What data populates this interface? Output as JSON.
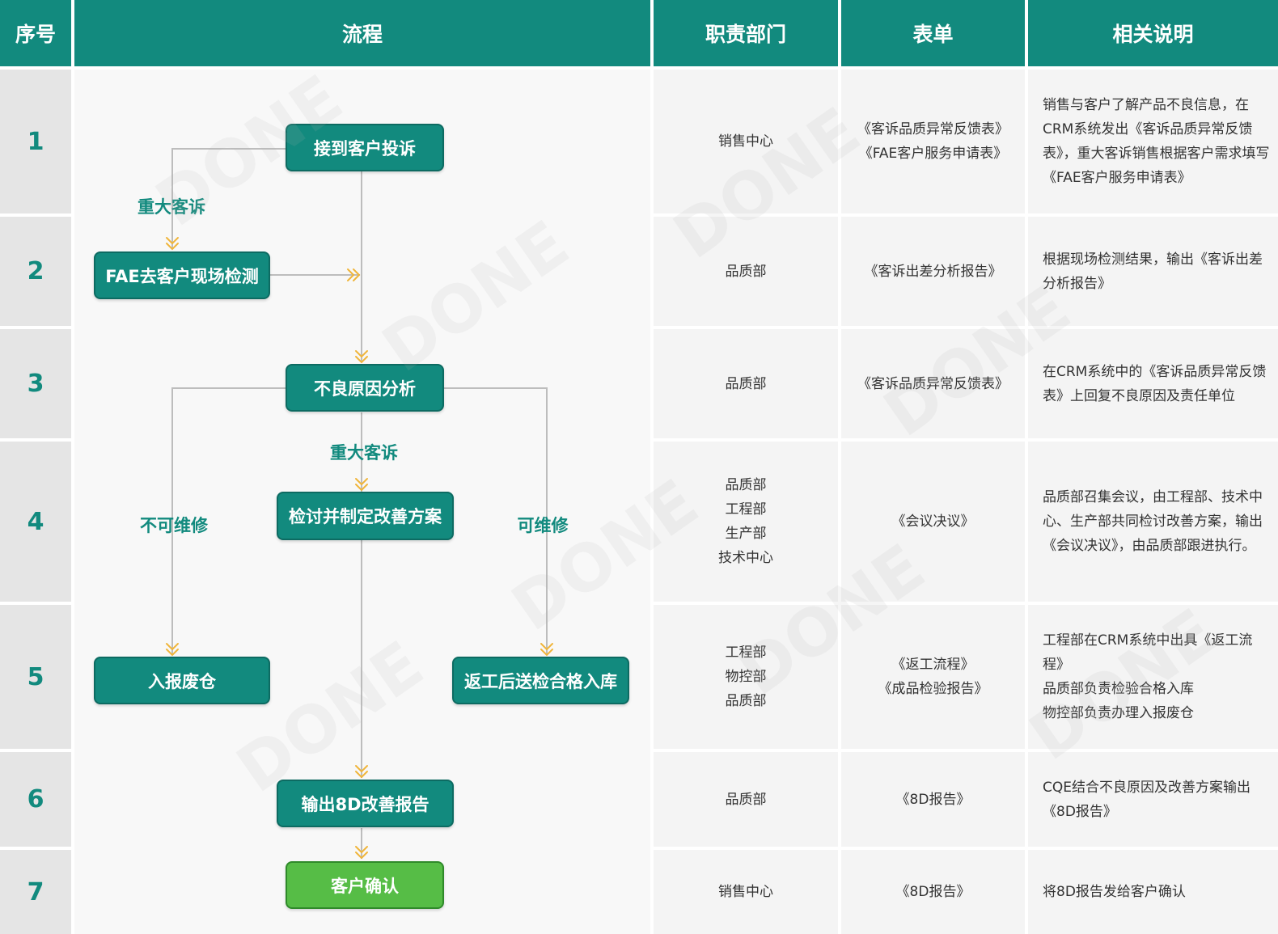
{
  "headers": {
    "seq": "序号",
    "flow": "流程",
    "dept": "职责部门",
    "form": "表单",
    "desc": "相关说明"
  },
  "rows": [
    {
      "seq": "1",
      "dept": "销售中心",
      "form": "《客诉品质异常反馈表》\n《FAE客户服务申请表》",
      "desc": "销售与客户了解产品不良信息，在CRM系统发出《客诉品质异常反馈表》，重大客诉销售根据客户需求填写《FAE客户服务申请表》"
    },
    {
      "seq": "2",
      "dept": "品质部",
      "form": "《客诉出差分析报告》",
      "desc": "根据现场检测结果，输出《客诉出差分析报告》"
    },
    {
      "seq": "3",
      "dept": "品质部",
      "form": "《客诉品质异常反馈表》",
      "desc": "在CRM系统中的《客诉品质异常反馈表》上回复不良原因及责任单位"
    },
    {
      "seq": "4",
      "dept": "品质部\n工程部\n生产部\n技术中心",
      "form": "《会议决议》",
      "desc": "品质部召集会议，由工程部、技术中心、生产部共同检讨改善方案，输出《会议决议》，由品质部跟进执行。"
    },
    {
      "seq": "5",
      "dept": "工程部\n物控部\n品质部",
      "form": "《返工流程》\n《成品检验报告》",
      "desc": "工程部在CRM系统中出具《返工流程》\n品质部负责检验合格入库\n物控部负责办理入报废仓"
    },
    {
      "seq": "6",
      "dept": "品质部",
      "form": "《8D报告》",
      "desc": "CQE结合不良原因及改善方案输出《8D报告》"
    },
    {
      "seq": "7",
      "dept": "销售中心",
      "form": "《8D报告》",
      "desc": "将8D报告发给客户确认"
    }
  ],
  "flow": {
    "nodes": {
      "receive": "接到客户投诉",
      "fae": "FAE去客户现场检测",
      "analysis": "不良原因分析",
      "improve": "检讨并制定改善方案",
      "scrap": "入报废仓",
      "rework": "返工后送检合格入库",
      "report8d": "输出8D改善报告",
      "confirm": "客户确认"
    },
    "labels": {
      "major1": "重大客诉",
      "major2": "重大客诉",
      "notRepairable": "不可维修",
      "repairable": "可维修"
    }
  },
  "watermark": "DONE",
  "colors": {
    "header": "#128a7e",
    "node": "#128a7e",
    "final_node": "#56bd46",
    "arrow": "#f0b53a",
    "line": "#bdbdbd"
  }
}
